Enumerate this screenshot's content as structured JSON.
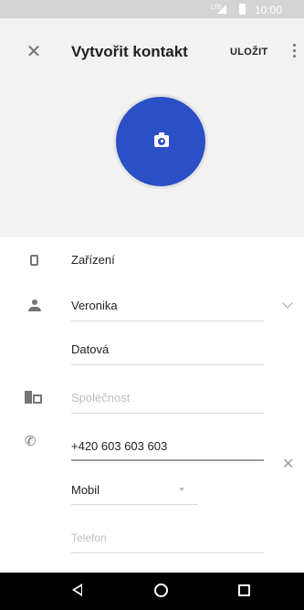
{
  "status_bar": {
    "network": "LTE",
    "time": "10:00"
  },
  "header": {
    "title": "Vytvořit kontakt",
    "save_label": "ULOŽIT",
    "photo_button_color": "#2b4fc4"
  },
  "form": {
    "account": "Zařízení",
    "first_name": "Veronika",
    "last_name": "Datová",
    "company_placeholder": "Společnost",
    "phone_value": "+420 603 603 603",
    "phone_type": "Mobil",
    "phone_placeholder": "Telefon"
  }
}
